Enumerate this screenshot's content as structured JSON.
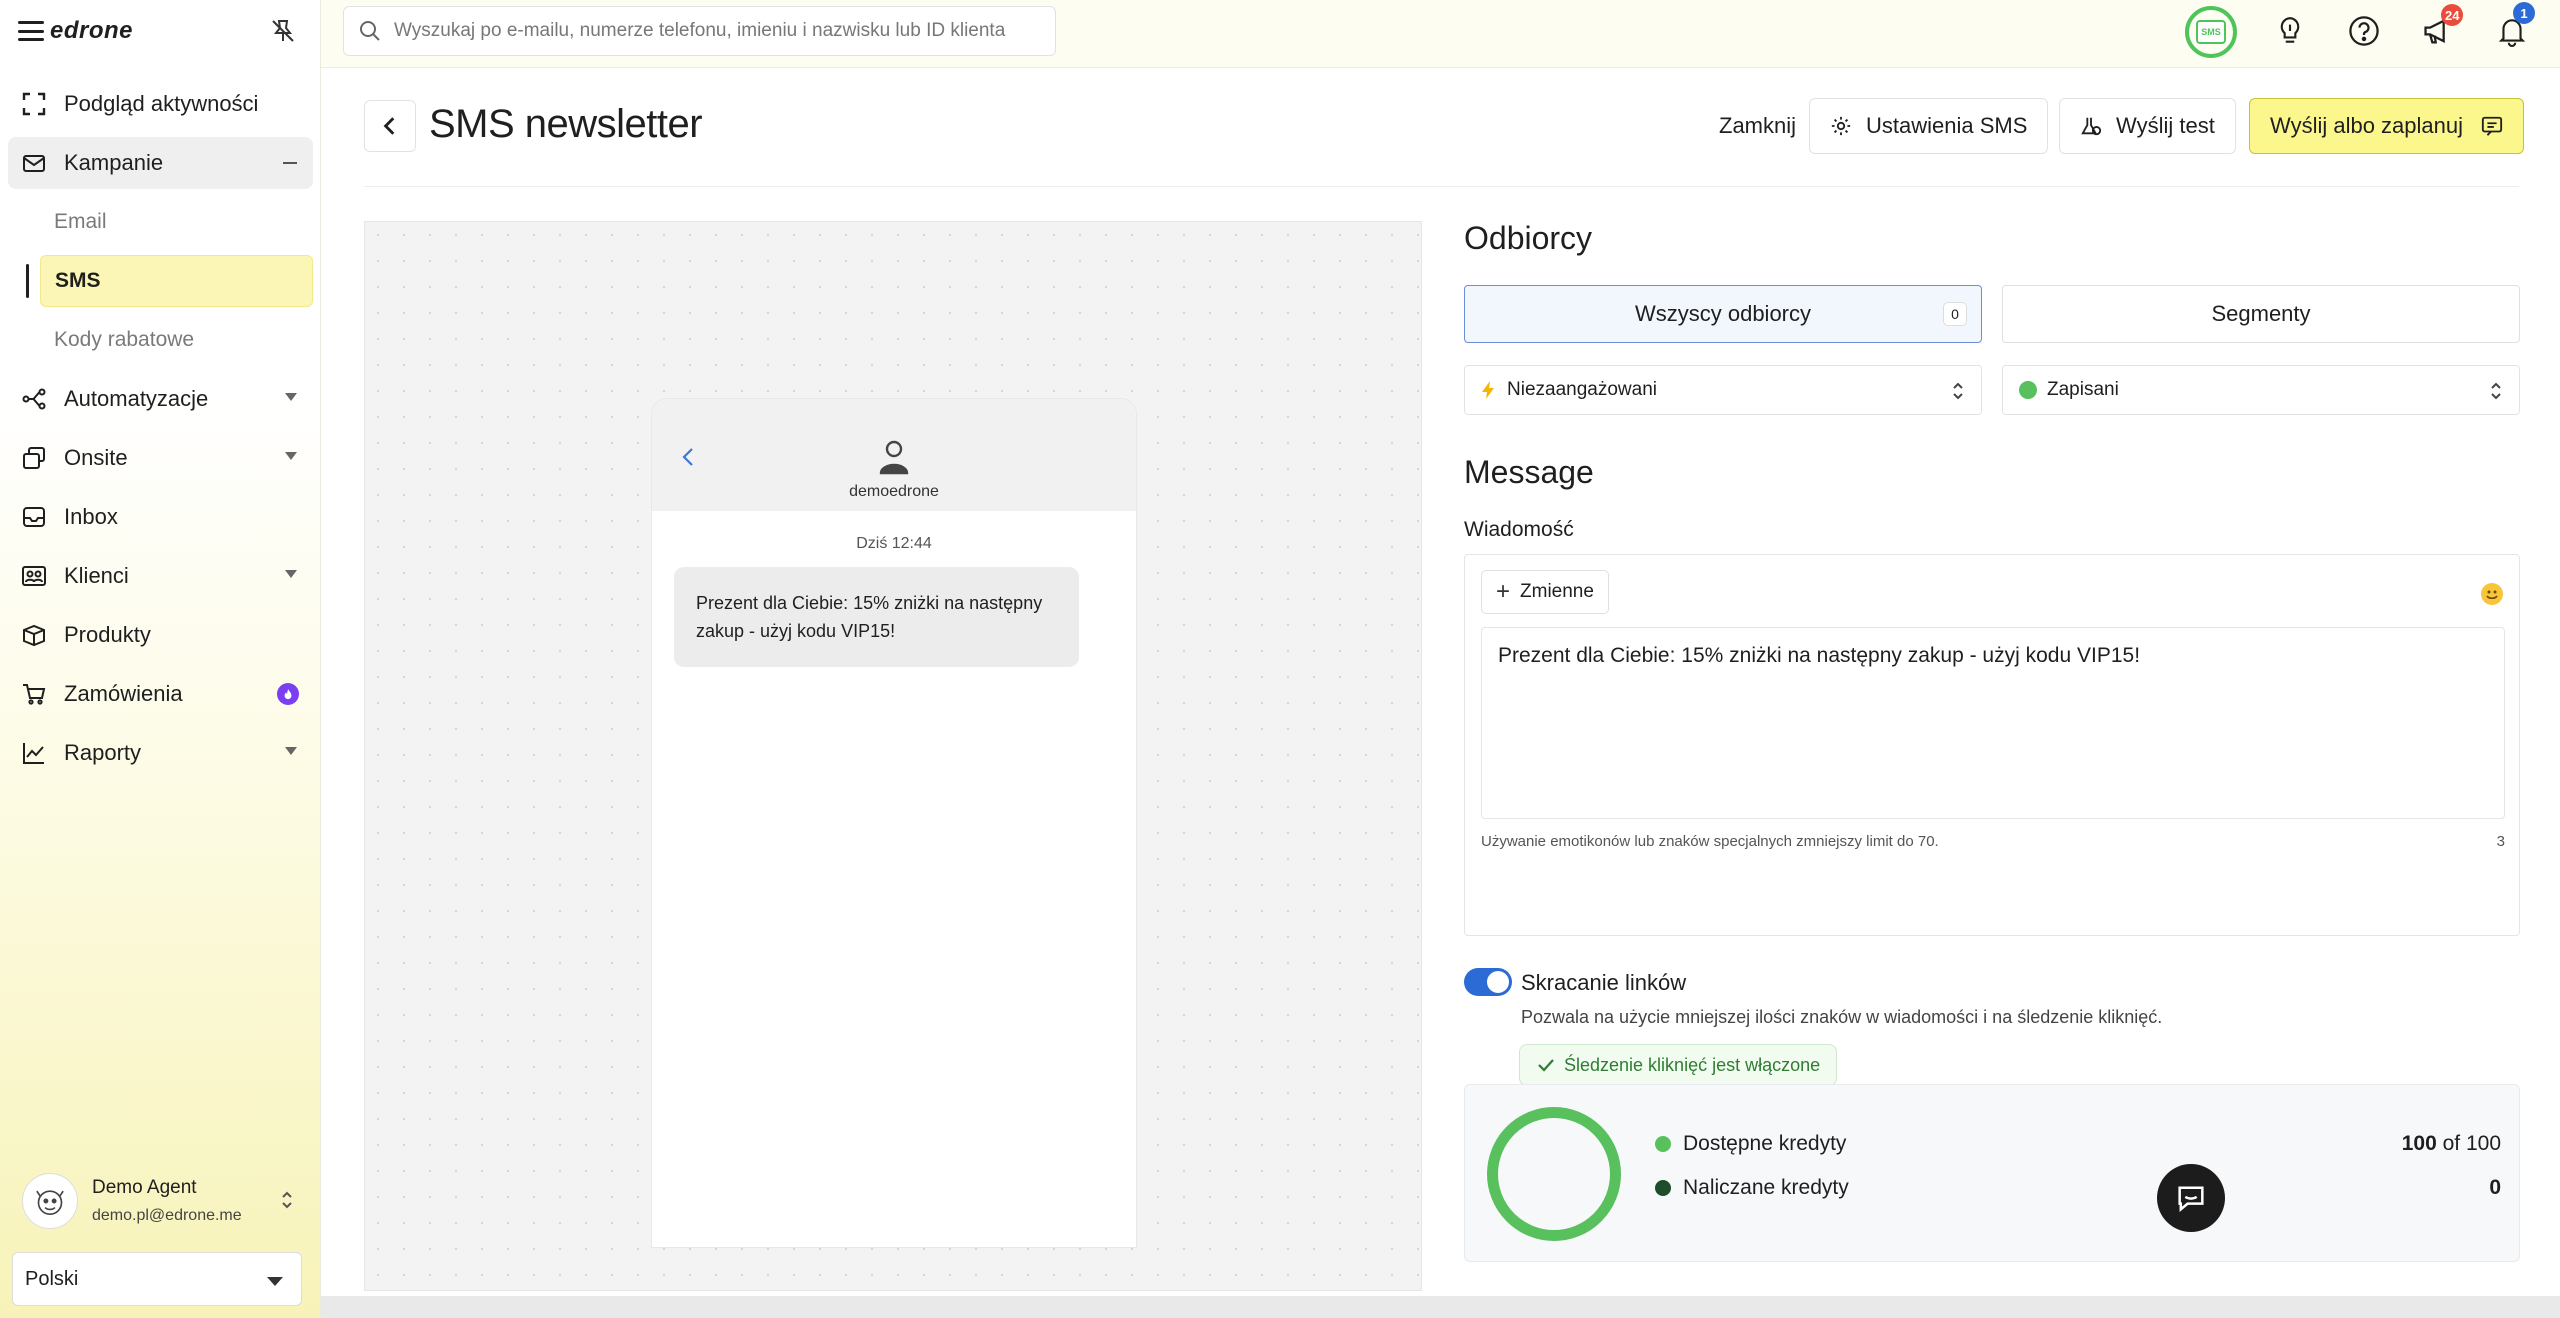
{
  "app": {
    "logo": "edrone"
  },
  "search": {
    "placeholder": "Wyszukaj po e-mailu, numerze telefonu, imieniu i nazwisku lub ID klienta"
  },
  "topbar": {
    "sms_label": "SMS",
    "campaigns_badge": "24",
    "notifications_badge": "1"
  },
  "sidebar": {
    "items": [
      {
        "label": "Podgląd aktywności",
        "icon": "expand-icon"
      },
      {
        "label": "Kampanie",
        "icon": "envelope-icon"
      },
      {
        "label": "Automatyzacje",
        "icon": "flow-icon"
      },
      {
        "label": "Onsite",
        "icon": "layers-icon"
      },
      {
        "label": "Inbox",
        "icon": "inbox-icon"
      },
      {
        "label": "Klienci",
        "icon": "users-icon"
      },
      {
        "label": "Produkty",
        "icon": "box-icon"
      },
      {
        "label": "Zamówienia",
        "icon": "cart-icon"
      },
      {
        "label": "Raporty",
        "icon": "chart-icon"
      }
    ],
    "subitems": [
      {
        "label": "Email"
      },
      {
        "label": "SMS"
      },
      {
        "label": "Kody rabatowe"
      }
    ],
    "user": {
      "name": "Demo Agent",
      "email": "demo.pl@edrone.me"
    },
    "language": "Polski"
  },
  "header": {
    "title": "SMS newsletter",
    "close_label": "Zamknij",
    "settings_label": "Ustawienia SMS",
    "test_label": "Wyślij test",
    "send_label": "Wyślij albo zaplanuj"
  },
  "preview": {
    "sender": "demoedrone",
    "time": "Dziś 12:44",
    "message": "Prezent dla Ciebie: 15% zniżki na następny zakup - użyj kodu VIP15!"
  },
  "recipients": {
    "title": "Odbiorcy",
    "tab_all": "Wszyscy odbiorcy",
    "tab_all_count": "0",
    "tab_segments": "Segmenty",
    "filter_engagement": "Niezaangażowani",
    "filter_status": "Zapisani"
  },
  "message": {
    "title": "Message",
    "field_label": "Wiadomość",
    "variables_label": "Zmienne",
    "text": "Prezent dla Ciebie: 15% zniżki na następny zakup - użyj kodu VIP15!",
    "hint": "Używanie emotikonów lub znaków specjalnych zmniejszy limit do 70.",
    "count": "3"
  },
  "links": {
    "toggle_label": "Skracanie linków",
    "toggle_on": true,
    "description": "Pozwala na użycie mniejszej ilości znaków w wiadomości i na śledzenie kliknięć.",
    "tracking_label": "Śledzenie kliknięć jest włączone"
  },
  "credits": {
    "available_label": "Dostępne kredyty",
    "available_value": "100",
    "available_of": "of 100",
    "charged_label": "Naliczane kredyty",
    "charged_value": "0",
    "available_fraction": 1.0
  },
  "colors": {
    "accent_yellow": "#fbf78d",
    "brand_green": "#58c05d",
    "toggle_blue": "#2c6bd6",
    "badge_red": "#e74c3c",
    "badge_blue": "#2c6bd6",
    "fire_purple": "#7b3ff2"
  }
}
